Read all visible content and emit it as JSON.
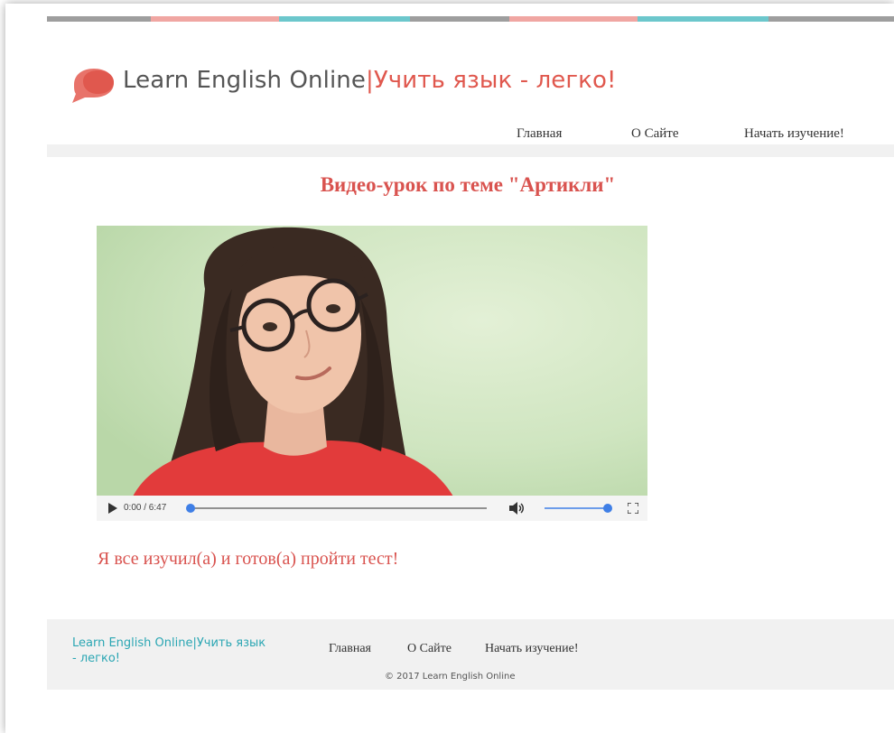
{
  "colors": {
    "accent_red": "#e0584e",
    "title_red": "#d9534f",
    "footer_teal": "#2aa6b3",
    "stripe": [
      "#9e9e9e",
      "#f0a6a2",
      "#6cc7cc",
      "#9e9e9e",
      "#f0a6a2",
      "#6cc7cc",
      "#9e9e9e"
    ]
  },
  "header": {
    "brand_name": "Learn English Online",
    "brand_separator": "|",
    "brand_tagline": "Учить язык - легко!",
    "logo_icon": "speech-bubble-icon"
  },
  "nav": {
    "items": [
      {
        "label": "Главная"
      },
      {
        "label": "О Сайте"
      },
      {
        "label": "Начать изучение!"
      }
    ]
  },
  "main": {
    "video_title": "Видео-урок по теме \"Артикли\"",
    "player": {
      "time_display": "0:00 / 6:47",
      "progress_fraction": 0.0,
      "volume_fraction": 1.0,
      "play_icon": "play-icon",
      "volume_icon": "volume-icon",
      "fullscreen_icon": "fullscreen-icon"
    },
    "cta_text": "Я все изучил(а) и готов(а) пройти тест!"
  },
  "footer": {
    "brand_text": "Learn English Online|Учить язык - легко!",
    "nav": [
      {
        "label": "Главная"
      },
      {
        "label": "О Сайте"
      },
      {
        "label": "Начать изучение!"
      }
    ],
    "copyright": "© 2017 Learn English Online"
  }
}
